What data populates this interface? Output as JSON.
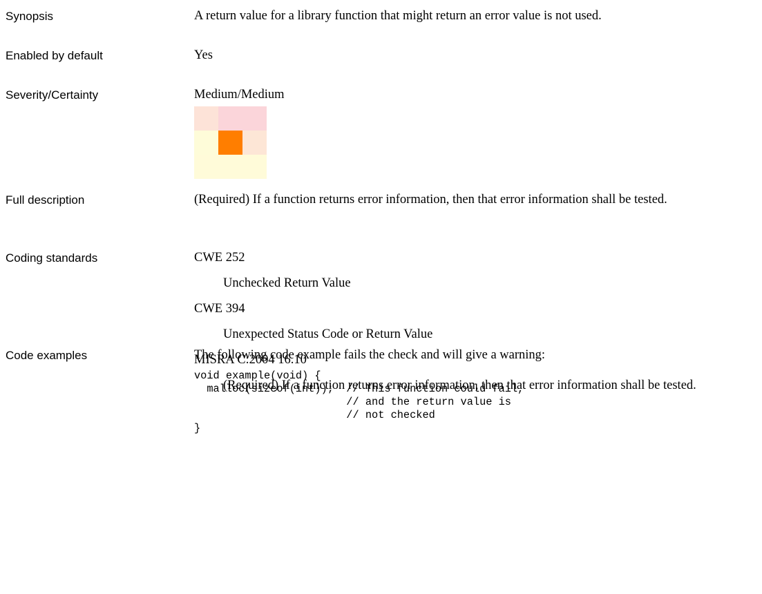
{
  "synopsis": {
    "label": "Synopsis",
    "text": "A return value for a library function that might return an error value is not used."
  },
  "enabled_by_default": {
    "label": "Enabled by default",
    "text": "Yes"
  },
  "severity_certainty": {
    "label": "Severity/Certainty",
    "text": "Medium/Medium",
    "grid_colors": [
      [
        "#fde3d8",
        "#fbd5da",
        "#fbd5da"
      ],
      [
        "#fefcd9",
        "#ff7e00",
        "#fde6d6"
      ],
      [
        "#fffbd9",
        "#fffbd9",
        "#fffbd9"
      ]
    ]
  },
  "full_description": {
    "label": "Full description",
    "text": "(Required) If a function returns error information, then that error information shall be tested."
  },
  "coding_standards": {
    "label": "Coding standards",
    "items": [
      {
        "name": "CWE 252",
        "desc": "Unchecked Return Value"
      },
      {
        "name": "CWE 394",
        "desc": "Unexpected Status Code or Return Value"
      },
      {
        "name": "MISRA C:2004 16.10",
        "desc": "(Required) If a function returns error information, then that error information shall be tested."
      }
    ]
  },
  "code_examples": {
    "label": "Code examples",
    "intro": "The following code example fails the check and will give a warning:",
    "code": "void example(void) {\n  malloc(sizeof(int));  // This function could fail,\n                        // and the return value is\n                        // not checked\n}"
  }
}
